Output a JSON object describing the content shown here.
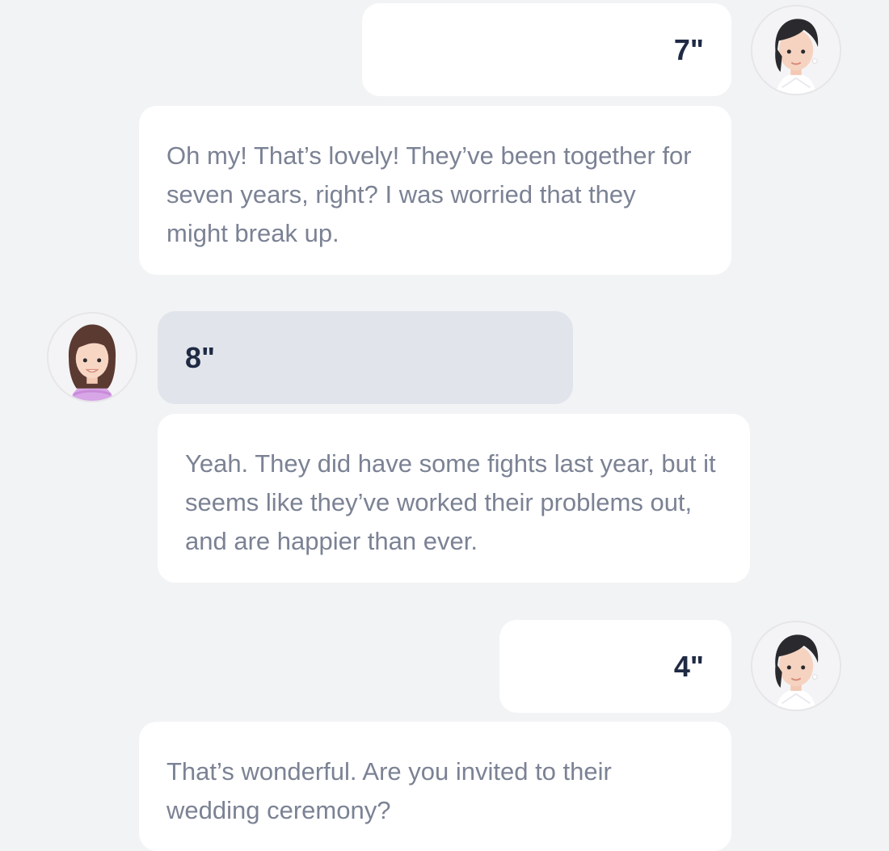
{
  "conversation": {
    "messages": [
      {
        "speaker": "right",
        "type": "audio",
        "duration": "7\""
      },
      {
        "speaker": "right",
        "type": "transcript",
        "text": "Oh my! That’s lovely! They’ve been together for seven years, right? I was worried that they might break up."
      },
      {
        "speaker": "left",
        "type": "audio",
        "duration": "8\""
      },
      {
        "speaker": "left",
        "type": "transcript",
        "text": "Yeah. They did have some fights last year, but it seems like they’ve worked their problems out, and are happier than ever."
      },
      {
        "speaker": "right",
        "type": "audio",
        "duration": "4\""
      },
      {
        "speaker": "right",
        "type": "transcript",
        "text": "That’s wonderful. Are you invited to their wedding ceremony?"
      }
    ]
  },
  "colors": {
    "background": "#f2f3f5",
    "bubble_white": "#ffffff",
    "bubble_left_audio": "#e1e5eb",
    "duration_text": "#1f2a44",
    "transcript_text": "#7b8294"
  },
  "icons": {
    "right_avatar": "woman-avatar-icon",
    "left_avatar": "girl-avatar-icon"
  }
}
